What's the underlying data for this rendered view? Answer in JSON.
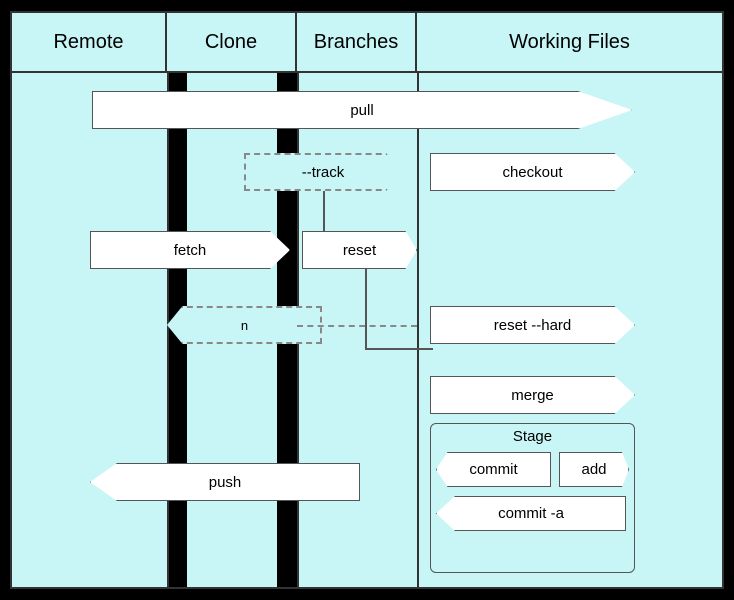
{
  "header": {
    "remote_label": "Remote",
    "clone_label": "Clone",
    "branches_label": "Branches",
    "working_label": "Working Files"
  },
  "arrows": {
    "pull": "pull",
    "track": "--track",
    "checkout": "checkout",
    "fetch": "fetch",
    "reset": "reset",
    "merge": "merge",
    "reset_hard": "reset --hard",
    "push": "push",
    "commit": "commit",
    "add": "add",
    "commit_a": "commit -a",
    "stage": "Stage"
  }
}
